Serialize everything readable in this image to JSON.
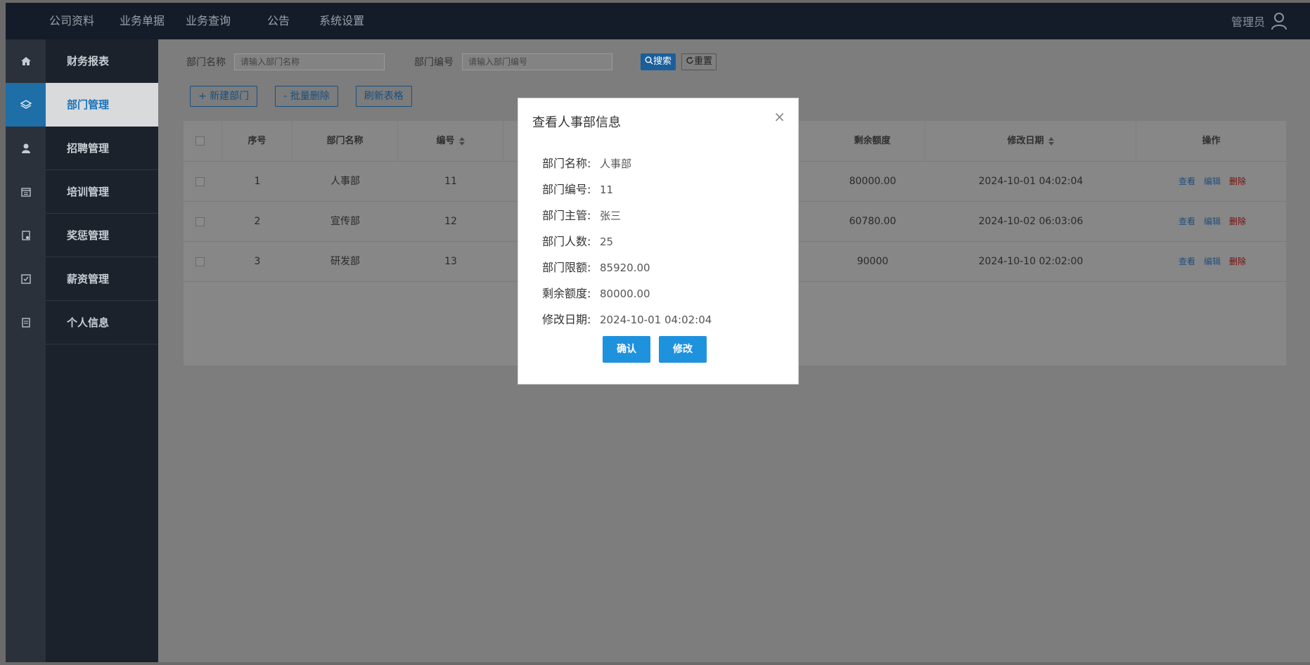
{
  "topnav": {
    "items": [
      "公司资料",
      "业务单据",
      "业务查询",
      "公告",
      "系统设置"
    ],
    "user": "管理员"
  },
  "sidebar": {
    "items": [
      {
        "label": "财务报表",
        "icon": "home-icon"
      },
      {
        "label": "部门管理",
        "icon": "layers-icon"
      },
      {
        "label": "招聘管理",
        "icon": "person-icon"
      },
      {
        "label": "培训管理",
        "icon": "calendar-icon"
      },
      {
        "label": "奖惩管理",
        "icon": "award-icon"
      },
      {
        "label": "薪资管理",
        "icon": "checklist-icon"
      },
      {
        "label": "个人信息",
        "icon": "profile-icon"
      }
    ],
    "active_index": 1
  },
  "filter": {
    "name_label": "部门名称",
    "name_placeholder": "请输入部门名称",
    "code_label": "部门编号",
    "code_placeholder": "请输入部门编号",
    "search_label": "搜索",
    "reset_label": "重置"
  },
  "actions": {
    "new_label": "+ 新建部门",
    "batch_delete_label": "- 批量删除",
    "refresh_label": "刷新表格"
  },
  "table": {
    "headers": {
      "index": "序号",
      "name": "部门名称",
      "code": "编号",
      "remaining": "剩余额度",
      "modified": "修改日期",
      "ops": "操作"
    },
    "rows": [
      {
        "index": "1",
        "name": "人事部",
        "code": "11",
        "remaining": "80000.00",
        "modified": "2024-10-01 04:02:04"
      },
      {
        "index": "2",
        "name": "宣传部",
        "code": "12",
        "remaining": "60780.00",
        "modified": "2024-10-02 06:03:06"
      },
      {
        "index": "3",
        "name": "研发部",
        "code": "13",
        "remaining": "90000",
        "modified": "2024-10-10 02:02:00"
      }
    ],
    "op_labels": {
      "view": "查看",
      "edit": "编辑",
      "delete": "删除"
    }
  },
  "modal": {
    "title": "查看人事部信息",
    "close": "×",
    "fields": [
      {
        "label": "部门名称:",
        "value": "人事部"
      },
      {
        "label": "部门编号:",
        "value": "11"
      },
      {
        "label": "部门主管:",
        "value": "张三"
      },
      {
        "label": "部门人数:",
        "value": "25"
      },
      {
        "label": "部门限额:",
        "value": "85920.00"
      },
      {
        "label": "剩余额度:",
        "value": "80000.00"
      },
      {
        "label": "修改日期:",
        "value": "2024-10-01 04:02:04"
      }
    ],
    "confirm_label": "确认",
    "edit_label": "修改"
  }
}
